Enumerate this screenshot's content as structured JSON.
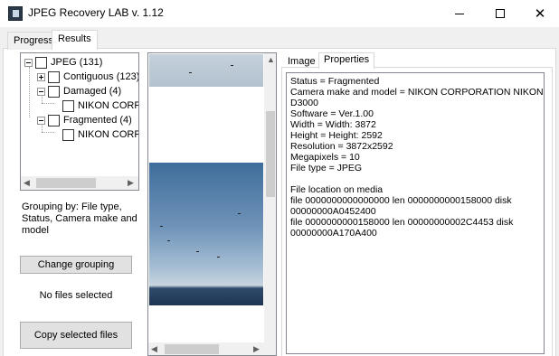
{
  "window": {
    "title": "JPEG Recovery LAB v. 1.12",
    "minimize": "—",
    "maximize": "☐",
    "close": "✕"
  },
  "tabs": [
    {
      "label": "Progress"
    },
    {
      "label": "Results"
    }
  ],
  "tree": {
    "nodes": [
      {
        "label": "JPEG (131)"
      },
      {
        "label": "Contiguous (123)"
      },
      {
        "label": "Damaged (4)"
      },
      {
        "label": "NIKON CORPO"
      },
      {
        "label": "Fragmented (4)"
      },
      {
        "label": "NIKON CORPO"
      }
    ]
  },
  "left": {
    "grouping_text": "Grouping by: File type, Status, Camera make and model",
    "change_grouping": "Change grouping",
    "no_files": "No files selected",
    "copy_files": "Copy selected files"
  },
  "right_tabs": [
    {
      "label": "Image"
    },
    {
      "label": "Properties"
    }
  ],
  "properties": {
    "lines": [
      "Status = Fragmented",
      "Camera make and model = NIKON CORPORATION NIKON",
      "D3000",
      "Software = Ver.1.00",
      "Width = Width: 3872",
      "Height = Height: 2592",
      "Resolution = 3872x2592",
      "Megapixels = 10",
      "File type = JPEG",
      "",
      "File location on media",
      "file 0000000000000000 len 0000000000158000 disk",
      "00000000A0452400",
      "file 0000000000158000 len 00000000002C4453 disk",
      "00000000A170A400"
    ]
  },
  "icons": {
    "app": "app-icon",
    "scroll_left": "◀",
    "scroll_right": "▶",
    "scroll_up": "▲",
    "scroll_down": "▼"
  }
}
